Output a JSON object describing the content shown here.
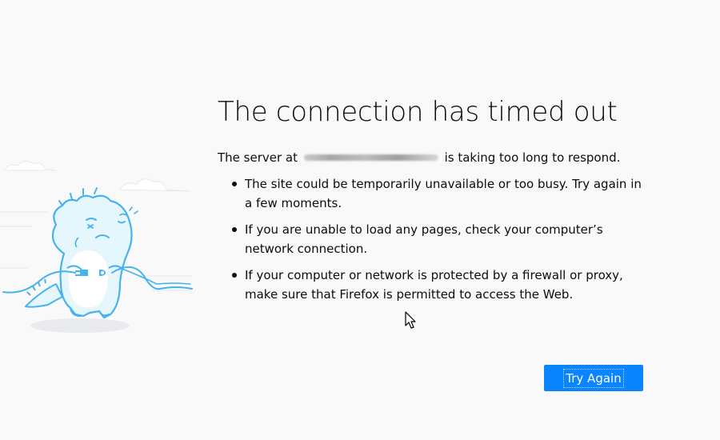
{
  "page": {
    "title": "The connection has timed out",
    "intro_before": "The server at",
    "intro_after": "is taking too long to respond.",
    "reasons": [
      "The site could be temporarily unavailable or too busy. Try again in a few moments.",
      "If you are unable to load any pages, check your computer’s network connection.",
      "If your computer or network is protected by a firewall or proxy, make sure that Firefox is permitted to access the Web."
    ],
    "button_label": "Try Again"
  },
  "colors": {
    "background": "#f9f9fa",
    "accent": "#0a84ff",
    "illustration_stroke": "#45b3ef",
    "illustration_fill": "#e6f6fd",
    "text": "#0c0c0d"
  },
  "icons": {
    "illustration": "dinosaur-unplugged-illustration",
    "cursor": "mouse-pointer-icon"
  }
}
